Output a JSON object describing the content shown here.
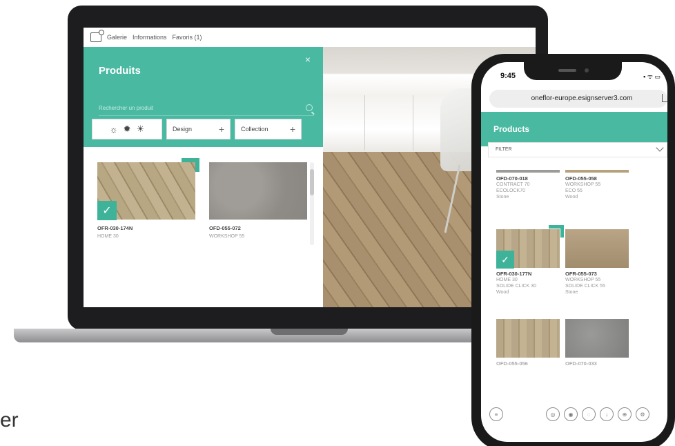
{
  "laptop": {
    "nav": [
      "Galerie",
      "Informations",
      "Favoris (1)"
    ],
    "panel": {
      "title": "Produits",
      "close": "×",
      "search_placeholder": "Rechercher un produit",
      "filters": {
        "lights": [
          "☼",
          "✹",
          "☀"
        ],
        "design": "Design",
        "collection": "Collection",
        "plus": "+"
      },
      "products": [
        {
          "code": "OFR-030-174N",
          "collection": "HOME 30"
        },
        {
          "code": "OFD-055-072",
          "collection": "WORKSHOP 55"
        }
      ]
    },
    "compare_icon": "▯▯"
  },
  "phone": {
    "time": "9:45",
    "status": "▪ ᯤ ▭",
    "url": "oneflor-europe.esignserver3.com",
    "header": "Products",
    "filter": "FILTER",
    "products": [
      {
        "code": "OFD-070-018",
        "lines": [
          "CONTRACT 70",
          "ECOLOCK70",
          "Stone"
        ]
      },
      {
        "code": "OFD-055-058",
        "lines": [
          "WORKSHOP 55",
          "ECO 55",
          "Wood"
        ]
      },
      {
        "code": "OFR-030-177N",
        "lines": [
          "HOME 30",
          "SOLIDE CLICK 30",
          "Wood"
        ]
      },
      {
        "code": "OFR-055-073",
        "lines": [
          "WORKSHOP 55",
          "SOLIDE CLICK 55",
          "Stone"
        ]
      },
      {
        "code": "OFD-055-056",
        "lines": []
      },
      {
        "code": "OFD-070-033",
        "lines": []
      }
    ],
    "toolbar_icons": [
      "menu-icon",
      "compare-icon",
      "view-icon",
      "layers-icon",
      "download-icon",
      "share-icon",
      "settings-icon"
    ]
  },
  "partial_text": "er",
  "colors": {
    "teal": "#49b9a1",
    "teal_dark": "#3fb29a"
  }
}
